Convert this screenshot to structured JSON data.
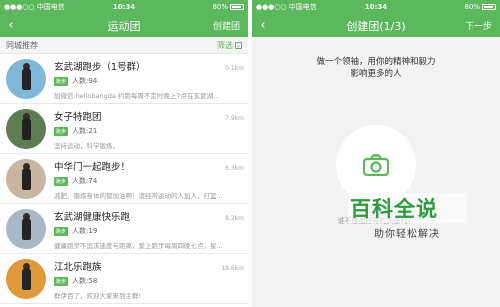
{
  "colors": {
    "brand": "#5bb85b",
    "tag": "#5bb85b"
  },
  "left": {
    "statusbar": {
      "carrier": "●●●○○ 中国电信 ",
      "time": "10:34",
      "battery": "80%"
    },
    "navbar": {
      "back": "‹",
      "title": "运动团",
      "action": "创建团"
    },
    "filter_bar": {
      "label": "同城推荐",
      "filter_label": "筛选",
      "filter_icon": "filter-icon"
    },
    "groups": [
      {
        "name": "玄武湖跑步（1号群）",
        "distance": "0.1km",
        "tag": "跑步",
        "count": "人数:94",
        "desc": "加微信:hellobangda    约跑每周不定时晚上7点在玄武湖...",
        "avatar_bg": "#7fb8d9"
      },
      {
        "name": "女子特跑团",
        "distance": "7.9km",
        "tag": "跑步",
        "count": "人数:21",
        "desc": "坚持运动，科学锻炼。",
        "avatar_bg": "#5e7d52"
      },
      {
        "name": "中华门一起跑步！",
        "distance": "6.3km",
        "tag": "跑步",
        "count": "人数:74",
        "desc": "减肥、锻炼身体的都加油啊！请经常运动的人加入，打篮...",
        "avatar_bg": "#c9b6a0"
      },
      {
        "name": "玄武湖健康快乐跑",
        "distance": "8.2km",
        "tag": "跑步",
        "count": "人数:19",
        "desc": "健康跑步不追求速度与距离，爱上跑步每周四晚七点，星...",
        "avatar_bg": "#a7b9c4"
      },
      {
        "name": "江北乐跑族",
        "distance": "18.6km",
        "tag": "跑步",
        "count": "人数:58",
        "desc": "群伊百了，欢迎大家来到主群!",
        "avatar_bg": "#e09a3c"
      }
    ]
  },
  "right": {
    "statusbar": {
      "carrier": "●●●○○ 中国电信 ",
      "time": "10:34",
      "battery": "80%"
    },
    "navbar": {
      "back": "‹",
      "title": "创建团(1/3)",
      "action": "下一步"
    },
    "slogan_line1": "做一个领袖，用你的精神和毅力",
    "slogan_line2": "影响更多的人",
    "camera_icon": "camera-icon",
    "hint": "谁不愿加好奇的头像吗？"
  },
  "watermark": {
    "title": "百科全说",
    "subtitle": "助你轻松解决"
  }
}
